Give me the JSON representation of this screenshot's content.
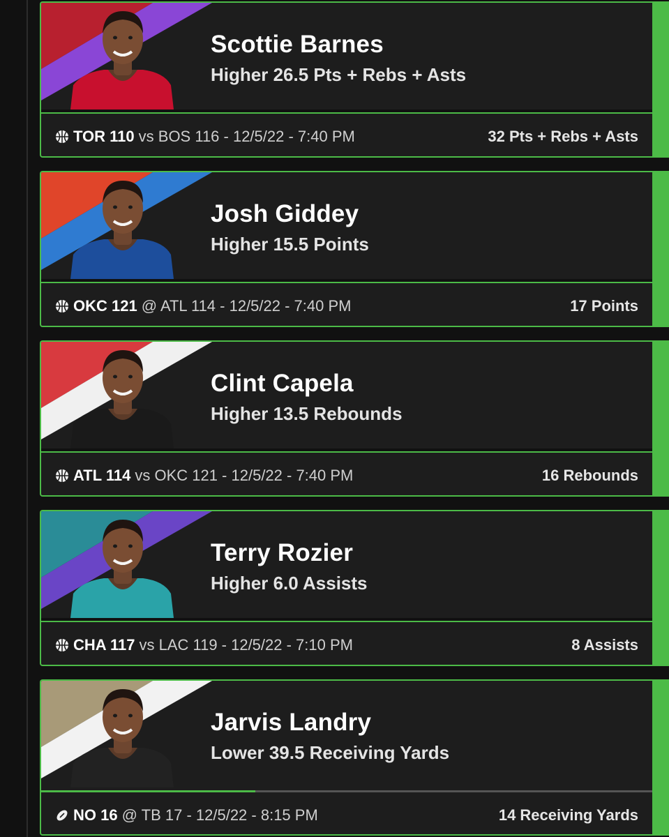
{
  "picks": [
    {
      "player": "Scottie Barnes",
      "direction": "Higher",
      "line": "26.5",
      "stat": "Pts + Rebs + Asts",
      "team": "TOR 110",
      "matchup": "vs BOS 116 - 12/5/22 - 7:40 PM",
      "result": "32 Pts + Rebs + Asts",
      "sport_icon": "basketball-icon",
      "stripe_colors": [
        "#b8202f",
        "#8a46d6"
      ],
      "jersey_color": "#c8102e"
    },
    {
      "player": "Josh Giddey",
      "direction": "Higher",
      "line": "15.5",
      "stat": "Points",
      "team": "OKC 121",
      "matchup": "@ ATL 114 - 12/5/22 - 7:40 PM",
      "result": "17 Points",
      "sport_icon": "basketball-icon",
      "stripe_colors": [
        "#e0452a",
        "#2f7bd1"
      ],
      "jersey_color": "#1d4e9c"
    },
    {
      "player": "Clint Capela",
      "direction": "Higher",
      "line": "13.5",
      "stat": "Rebounds",
      "team": "ATL 114",
      "matchup": "vs OKC 121 - 12/5/22 - 7:40 PM",
      "result": "16 Rebounds",
      "sport_icon": "basketball-icon",
      "stripe_colors": [
        "#d83a3f",
        "#f0f0f0"
      ],
      "jersey_color": "#1a1a1a"
    },
    {
      "player": "Terry Rozier",
      "direction": "Higher",
      "line": "6.0",
      "stat": "Assists",
      "team": "CHA 117",
      "matchup": "vs LAC 119 - 12/5/22 - 7:10 PM",
      "result": "8 Assists",
      "sport_icon": "basketball-icon",
      "stripe_colors": [
        "#2a8c97",
        "#6a45c6"
      ],
      "jersey_color": "#2aa3a8"
    },
    {
      "player": "Jarvis Landry",
      "direction": "Lower",
      "line": "39.5",
      "stat": "Receiving Yards",
      "team": "NO 16",
      "matchup": "@ TB 17 - 12/5/22 - 8:15 PM",
      "result": "14 Receiving Yards",
      "sport_icon": "football-icon",
      "stripe_colors": [
        "#a89a78",
        "#f2f2f2"
      ],
      "jersey_color": "#222222",
      "progress": 0.35
    }
  ]
}
